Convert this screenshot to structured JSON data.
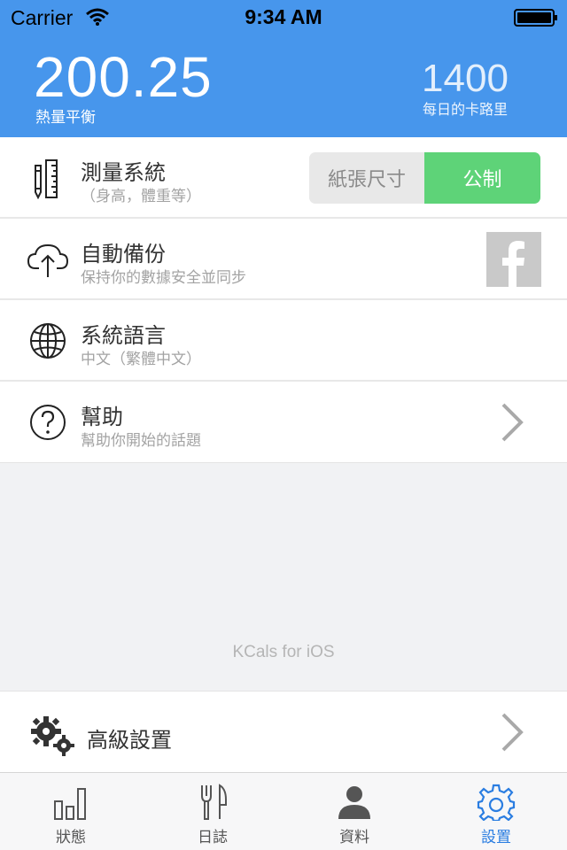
{
  "status_bar": {
    "carrier": "Carrier",
    "time": "9:34 AM"
  },
  "header": {
    "balance_value": "200.25",
    "balance_label": "熱量平衡",
    "daily_value": "1400",
    "daily_label": "每日的卡路里"
  },
  "settings": {
    "measurement": {
      "title": "測量系統",
      "subtitle": "（身高，體重等）",
      "option_left": "紙張尺寸",
      "option_right": "公制",
      "selected": "公制"
    },
    "backup": {
      "title": "自動備份",
      "subtitle": "保持你的數據安全並同步",
      "icon": "facebook-icon"
    },
    "language": {
      "title": "系統語言",
      "subtitle": "中文（繁體中文）"
    },
    "help": {
      "title": "幫助",
      "subtitle": "幫助你開始的話題"
    }
  },
  "footer_text": "KCals for iOS",
  "advanced": {
    "title": "高級設置"
  },
  "tabs": [
    {
      "label": "狀態",
      "icon": "bar-chart-icon"
    },
    {
      "label": "日誌",
      "icon": "fork-knife-icon"
    },
    {
      "label": "資料",
      "icon": "person-icon"
    },
    {
      "label": "設置",
      "icon": "gear-icon",
      "active": true
    }
  ],
  "colors": {
    "header": "#4796ec",
    "toggle_on": "#5ed378",
    "tab_active": "#2a7de1"
  }
}
